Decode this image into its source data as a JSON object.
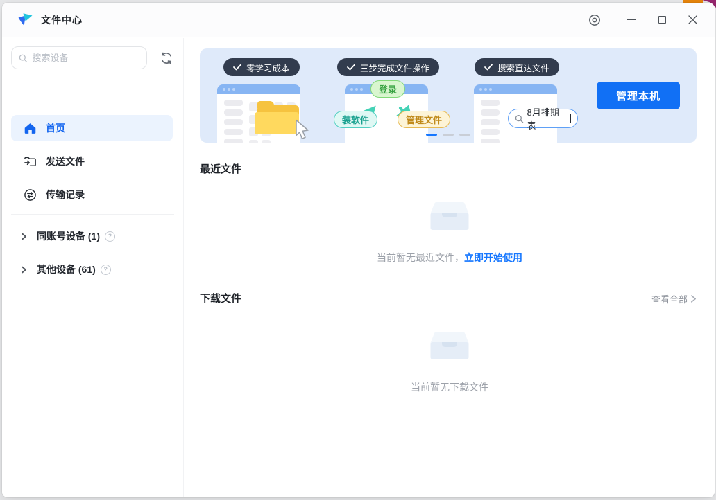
{
  "titlebar": {
    "title": "文件中心"
  },
  "sidebar": {
    "search_placeholder": "搜索设备",
    "items": [
      {
        "label": "首页",
        "active": true
      },
      {
        "label": "发送文件",
        "active": false
      },
      {
        "label": "传输记录",
        "active": false
      }
    ],
    "groups": [
      {
        "label": "同账号设备 (1)"
      },
      {
        "label": "其他设备 (61)"
      }
    ],
    "help_glyph": "?"
  },
  "banner": {
    "badges": [
      {
        "label": "零学习成本"
      },
      {
        "label": "三步完成文件操作"
      },
      {
        "label": "搜索直达文件"
      }
    ],
    "illustration": {
      "login_pill": "登录",
      "install_pill": "装软件",
      "manage_pill": "管理文件",
      "search_text": "8月排期表"
    },
    "manage_button": "管理本机",
    "carousel": {
      "active_index": 0,
      "count": 3
    }
  },
  "recent": {
    "title": "最近文件",
    "empty_text": "当前暂无最近文件，",
    "empty_link": "立即开始使用"
  },
  "downloads": {
    "title": "下载文件",
    "view_all": "查看全部",
    "empty_text": "当前暂无下载文件"
  },
  "colors": {
    "accent": "#1677ff",
    "button_blue": "#1170f5",
    "banner_bg": "#dfeafa",
    "badge_bg": "#323c4e",
    "active_item_bg": "#ebf3fe",
    "active_item_text": "#1365ef"
  }
}
